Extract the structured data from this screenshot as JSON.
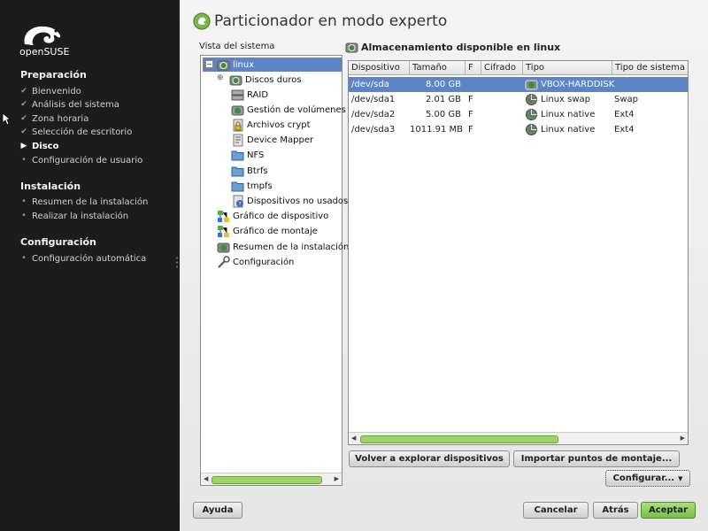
{
  "sidebar": {
    "logo_text": "openSUSE",
    "sections": [
      {
        "title": "Preparación",
        "steps": [
          "Bienvenido",
          "Análisis del sistema",
          "Zona horaria",
          "Selección de escritorio",
          "Disco",
          "Configuración de usuario"
        ]
      },
      {
        "title": "Instalación",
        "steps": [
          "Resumen de la instalación",
          "Realizar la instalación"
        ]
      },
      {
        "title": "Configuración",
        "steps": [
          "Configuración automática"
        ]
      }
    ]
  },
  "main": {
    "title": "Particionador en modo experto",
    "tree_label": "Vista del sistema",
    "tree_items": [
      {
        "label": "linux",
        "icon": "harddisk-icon"
      },
      {
        "label": "Discos duros",
        "icon": "harddisk-icon"
      },
      {
        "label": "RAID",
        "icon": "raid-icon"
      },
      {
        "label": "Gestión de volúmenes",
        "icon": "volume-manager-icon"
      },
      {
        "label": "Archivos crypt",
        "icon": "crypt-files-icon"
      },
      {
        "label": "Device Mapper",
        "icon": "device-mapper-icon"
      },
      {
        "label": "NFS",
        "icon": "folder-icon"
      },
      {
        "label": "Btrfs",
        "icon": "folder-icon"
      },
      {
        "label": "tmpfs",
        "icon": "folder-icon"
      },
      {
        "label": "Dispositivos no usados",
        "icon": "unused-devices-icon"
      },
      {
        "label": "Gráfico de dispositivo",
        "icon": "device-graph-icon"
      },
      {
        "label": "Gráfico de  montaje",
        "icon": "mount-graph-icon"
      },
      {
        "label": "Resumen de la instalación",
        "icon": "summary-icon"
      },
      {
        "label": "Configuración",
        "icon": "settings-icon"
      }
    ],
    "storage_title": "Almacenamiento disponible en linux",
    "columns": [
      "Dispositivo",
      "Tamaño",
      "F",
      "Cifrado",
      "Tipo",
      "Tipo de sistema"
    ],
    "rows": [
      {
        "device": "/dev/sda",
        "size": "8.00 GB",
        "f": "",
        "enc": "",
        "type": "VBOX-HARDDISK",
        "fs": ""
      },
      {
        "device": "/dev/sda1",
        "size": "2.01 GB",
        "f": "F",
        "enc": "",
        "type": "Linux swap",
        "fs": "Swap"
      },
      {
        "device": "/dev/sda2",
        "size": "5.00 GB",
        "f": "F",
        "enc": "",
        "type": "Linux native",
        "fs": "Ext4"
      },
      {
        "device": "/dev/sda3",
        "size": "1011.91 MB",
        "f": "F",
        "enc": "",
        "type": "Linux native",
        "fs": "Ext4"
      }
    ],
    "buttons": {
      "rescan": "Volver a explorar dispositivos",
      "import": "Importar puntos de montaje...",
      "configure": "Configurar...",
      "help": "Ayuda",
      "cancel": "Cancelar",
      "back": "Atrás",
      "accept": "Aceptar"
    }
  },
  "colors": {
    "selection": "#5d84c6",
    "accent_green": "#74c043",
    "sidebar_bg": "#1c1c1c"
  }
}
